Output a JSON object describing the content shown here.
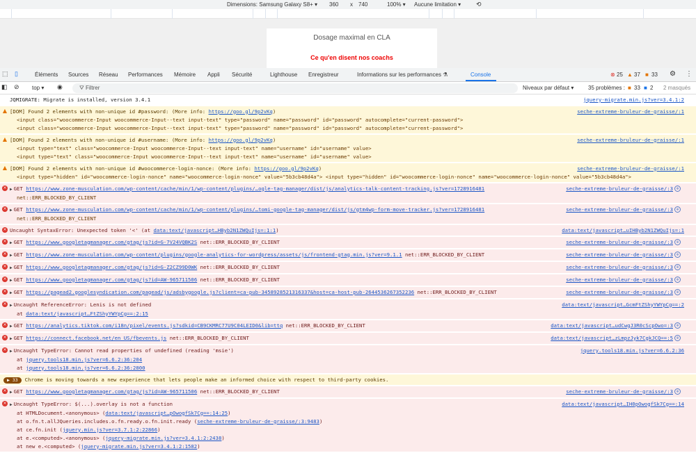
{
  "device_toolbar": {
    "dimensions": "Dimensions: Samsung Galaxy S8+ ▾",
    "width": "360",
    "times": "x",
    "height": "740",
    "zoom": "100% ▾",
    "throttle": "Aucune limitation ▾"
  },
  "page": {
    "heading": "Dosage maximal en CLA",
    "subheading": "Ce qu'en disent nos coachs"
  },
  "tabs": [
    "Éléments",
    "Sources",
    "Réseau",
    "Performances",
    "Mémoire",
    "Appli",
    "Sécurité",
    "Lighthouse",
    "Enregistreur",
    "Informations sur les performances ⚗",
    "Console"
  ],
  "counts": {
    "errors": "25",
    "warnings": "37",
    "info": "33"
  },
  "toolbar": {
    "context": "top ▾",
    "filter_placeholder": "Filtrer",
    "levels": "Niveaux par défaut ▾",
    "problems": "35 problèmes :",
    "problems_warn": "33",
    "problems_info": "2",
    "hidden": "2 masqués"
  },
  "colors": {
    "accent": "#1a73e8",
    "error_bg": "#fcebeb",
    "warning_bg": "#fef7d9",
    "error_icon": "#dc362e",
    "warning_icon": "#e37400"
  },
  "messages": [
    {
      "level": "log",
      "text": "JQMIGRATE: Migrate is installed, version 3.4.1",
      "source": "jquery-migrate.min.js?ver=3.4.1:2"
    },
    {
      "level": "warning",
      "text": "[DOM] Found 2 elements with non-unique id #password: (More info: ",
      "link": "https://goo.gl/9p2vKq",
      "after": ")",
      "source": "seche-extreme-bruleur-de-graisse/:1",
      "code": [
        "<input class=\"woocommerce-Input woocommerce-Input--text input-text\" type=\"password\" name=\"password\" id=\"password\" autocomplete=\"current-password\">",
        "<input class=\"woocommerce-Input woocommerce-Input--text input-text\" type=\"password\" name=\"password\" id=\"password\" autocomplete=\"current-password\">"
      ]
    },
    {
      "level": "warning",
      "text": "[DOM] Found 2 elements with non-unique id #username: (More info: ",
      "link": "https://goo.gl/9p2vKq",
      "after": ")",
      "source": "seche-extreme-bruleur-de-graisse/:1",
      "code": [
        "<input type=\"text\" class=\"woocommerce-Input woocommerce-Input--text input-text\" name=\"username\" id=\"username\" value>",
        "<input type=\"text\" class=\"woocommerce-Input woocommerce-Input--text input-text\" name=\"username\" id=\"username\" value>"
      ]
    },
    {
      "level": "warning",
      "text": "[DOM] Found 2 elements with non-unique id #woocommerce-login-nonce: (More info: ",
      "link": "https://goo.gl/9p2vKq",
      "after": ")",
      "source": "seche-extreme-bruleur-de-graisse/:1",
      "code": [
        "<input type=\"hidden\" id=\"woocommerce-login-nonce\" name=\"woocommerce-login-nonce\" value=\"5b3cb48d4a\">    <input type=\"hidden\" id=\"woocommerce-login-nonce\" name=\"woocommerce-login-nonce\" value=\"5b3cb48d4a\">"
      ]
    },
    {
      "level": "error",
      "arrow": true,
      "text": "GET ",
      "link": "https://www.zone-musculation.com/wp-content/cache/min/1/wp-content/plugins/…ogle-tag-manager/dist/js/analytics-talk-content-tracking.js?ver=1728916481",
      "source": "seche-extreme-bruleur-de-graisse/:3",
      "net": true,
      "code": [
        "net::ERR_BLOCKED_BY_CLIENT"
      ]
    },
    {
      "level": "error",
      "arrow": true,
      "text": "GET ",
      "link": "https://www.zone-musculation.com/wp-content/cache/min/1/wp-content/plugins/…tomi-google-tag-manager/dist/js/gtm4wp-form-move-tracker.js?ver=1728916481",
      "source": "seche-extreme-bruleur-de-graisse/:3",
      "net": true,
      "code": [
        "net::ERR_BLOCKED_BY_CLIENT"
      ]
    },
    {
      "level": "error",
      "text": "Uncaught SyntaxError: Unexpected token '<' (at ",
      "link": "data:text/javascript…HByb2N1ZWQuIjs=:1:1",
      "after": ")",
      "source": "data:text/javascript…uIHByb2N1ZWQuIjs=:1"
    },
    {
      "level": "error",
      "arrow": true,
      "text": "GET ",
      "link": "https://www.googletagmanager.com/gtag/js?id=G-7V24VQBK2S",
      "after": " net::ERR_BLOCKED_BY_CLIENT",
      "source": "seche-extreme-bruleur-de-graisse/:3",
      "net": true
    },
    {
      "level": "error",
      "arrow": true,
      "text": "GET ",
      "link": "https://www.zone-musculation.com/wp-content/plugins/google-analytics-for-wordpress/assets/js/frontend-gtag.min.js?ver=9.1.1",
      "after": " net::ERR_BLOCKED_BY_CLIENT",
      "source": "seche-extreme-bruleur-de-graisse/:3",
      "net": true
    },
    {
      "level": "error",
      "arrow": true,
      "text": "GET ",
      "link": "https://www.googletagmanager.com/gtag/js?id=G-Z2CZ99D0WK",
      "after": " net::ERR_BLOCKED_BY_CLIENT",
      "source": "seche-extreme-bruleur-de-graisse/:3",
      "net": true
    },
    {
      "level": "error",
      "arrow": true,
      "text": "GET ",
      "link": "https://www.googletagmanager.com/gtag/js?id=AW-965711506",
      "after": " net::ERR_BLOCKED_BY_CLIENT",
      "source": "seche-extreme-bruleur-de-graisse/:3",
      "net": true
    },
    {
      "level": "error",
      "arrow": true,
      "text": "GET ",
      "link": "https://pagead2.googlesyndication.com/pagead/js/adsbygoogle.js?client=ca-pub-3458928521316337&host=ca-host-pub-2644536267352236",
      "after": " net::ERR_BLOCKED_BY_CLIENT",
      "source": "seche-extreme-bruleur-de-graisse/:3",
      "net": true
    },
    {
      "level": "error",
      "arrow": true,
      "text": "Uncaught ReferenceError: Lenis is not defined",
      "source": "data:text/javascript…GcmFtZShyYWYpCg==:2",
      "stack": [
        {
          "pre": "at ",
          "link": "data:text/javascript…FtZShyYWYpCg==:2:15",
          "post": ""
        }
      ]
    },
    {
      "level": "error",
      "arrow": true,
      "text": "GET ",
      "link": "https://analytics.tiktok.com/i18n/pixel/events.js?sdkid=CB9CKMRC77U9C04LEID0&lib=ttq",
      "after": " net::ERR_BLOCKED_BY_CLIENT",
      "source": "data:text/javascript…udCwgJ3R0cScpOwo=:3",
      "net": true
    },
    {
      "level": "error",
      "arrow": true,
      "text": "GET ",
      "link": "https://connect.facebook.net/en_US/fbevents.js",
      "after": " net::ERR_BLOCKED_BY_CLIENT",
      "source": "data:text/javascript…zLmpzJyk7CgkJCQ==:5",
      "net": true
    },
    {
      "level": "error",
      "arrow": true,
      "text": "Uncaught TypeError: Cannot read properties of undefined (reading 'msie')",
      "source": "jquery.tools18.min.js?ver=6.6.2:36",
      "stack": [
        {
          "pre": "at ",
          "link": "jquery.tools18.min.js?ver=6.6.2:36:204",
          "post": ""
        },
        {
          "pre": "at ",
          "link": "jquery.tools18.min.js?ver=6.6.2:36:2800",
          "post": ""
        }
      ]
    },
    {
      "level": "info",
      "badge": "▶ 33",
      "text": "Chrome is moving towards a new experience that lets people make an informed choice with respect to third-party cookies."
    },
    {
      "level": "error",
      "arrow": true,
      "text": "GET ",
      "link": "https://www.googletagmanager.com/gtag/js?id=AW-965711506",
      "after": " net::ERR_BLOCKED_BY_CLIENT",
      "source": "seche-extreme-bruleur-de-graisse/:3",
      "net": true
    },
    {
      "level": "error",
      "arrow": true,
      "text": "Uncaught TypeError: $(...).overlay is not a function",
      "source": "data:text/javascript…IH0pOwogfSk7Cg==:14",
      "stack": [
        {
          "pre": "at HTMLDocument.<anonymous> (",
          "link": "data:text/javascript…pOwogfSk7Cg==:14:25",
          "post": ")"
        },
        {
          "pre": "at o.fn.t.allJQueries.includes.o.fn.ready.o.fn.init.ready (",
          "link": "seche-extreme-bruleur-de-graisse/:3:9483",
          "post": ")"
        },
        {
          "pre": "at ce.fn.init (",
          "link": "jquery.min.js?ver=3.7.1:2:22866",
          "post": ")"
        },
        {
          "pre": "at e.<computed>.<anonymous> (",
          "link": "jquery-migrate.min.js?ver=3.4.1:2:2438",
          "post": ")"
        },
        {
          "pre": "at new e.<computed> (",
          "link": "jquery-migrate.min.js?ver=3.4.1:2:1582",
          "post": ")"
        }
      ]
    }
  ]
}
